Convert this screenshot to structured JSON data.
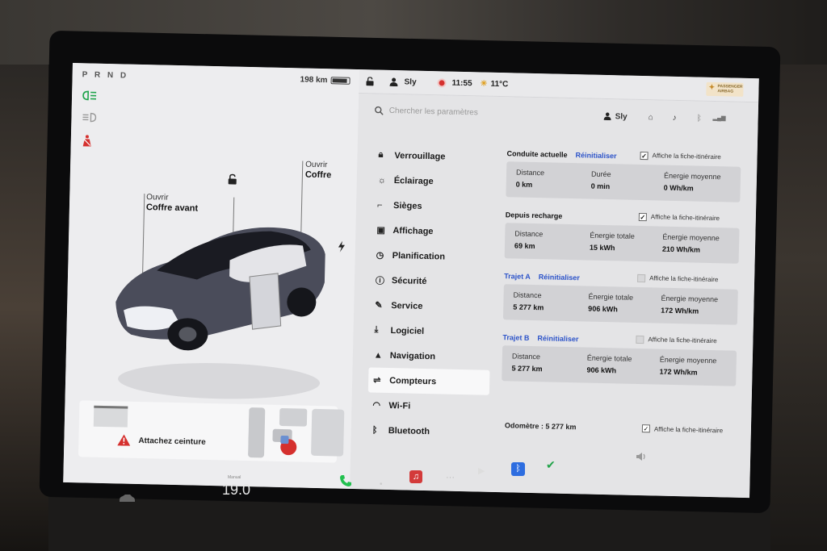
{
  "left_panel": {
    "gear": "P R N D",
    "range": "198 km",
    "battery_level": 0.8,
    "callout_trunk": {
      "line1": "Ouvrir",
      "line2": "Coffre"
    },
    "callout_frunk": {
      "line1": "Ouvrir",
      "line2": "Coffre avant"
    },
    "seatbelt_warning": "Attachez ceinture",
    "icons": [
      "headlights-icon",
      "high-beam-icon",
      "seatbelt-warning-icon",
      "unlock-icon",
      "charge-bolt-icon"
    ]
  },
  "status_bar": {
    "user": "Sly",
    "time": "11:55",
    "temperature": "11°C",
    "airbag_badge": "PASSENGER AIRBAG"
  },
  "settings": {
    "search_placeholder": "Chercher les paramètres",
    "profile": "Sly",
    "menu": [
      {
        "label": "Verrouillage",
        "icon": "lock-icon"
      },
      {
        "label": "Éclairage",
        "icon": "sun-icon"
      },
      {
        "label": "Sièges",
        "icon": "seat-icon"
      },
      {
        "label": "Affichage",
        "icon": "display-icon"
      },
      {
        "label": "Planification",
        "icon": "clock-icon"
      },
      {
        "label": "Sécurité",
        "icon": "info-icon"
      },
      {
        "label": "Service",
        "icon": "wrench-icon"
      },
      {
        "label": "Logiciel",
        "icon": "download-icon"
      },
      {
        "label": "Navigation",
        "icon": "navigation-icon"
      },
      {
        "label": "Compteurs",
        "icon": "trips-icon"
      },
      {
        "label": "Wi-Fi",
        "icon": "wifi-icon"
      },
      {
        "label": "Bluetooth",
        "icon": "bluetooth-icon"
      }
    ],
    "active_menu": "Compteurs",
    "reset_label": "Réinitialiser",
    "show_on_trip_card": "Affiche la fiche-itinéraire",
    "sections": {
      "current": {
        "title": "Conduite actuelle",
        "c1_label": "Distance",
        "c1_value": "0 km",
        "c2_label": "Durée",
        "c2_value": "0 min",
        "c3_label": "Énergie moyenne",
        "c3_value": "0 Wh/km",
        "checked": true
      },
      "since_charge": {
        "title": "Depuis recharge",
        "c1_label": "Distance",
        "c1_value": "69 km",
        "c2_label": "Énergie totale",
        "c2_value": "15 kWh",
        "c3_label": "Énergie moyenne",
        "c3_value": "210 Wh/km",
        "checked": true
      },
      "trip_a": {
        "title": "Trajet A",
        "c1_label": "Distance",
        "c1_value": "5 277 km",
        "c2_label": "Énergie totale",
        "c2_value": "906 kWh",
        "c3_label": "Énergie moyenne",
        "c3_value": "172 Wh/km",
        "checked": false
      },
      "trip_b": {
        "title": "Trajet B",
        "c1_label": "Distance",
        "c1_value": "5 277 km",
        "c2_label": "Énergie totale",
        "c2_value": "906 kWh",
        "c3_label": "Énergie moyenne",
        "c3_value": "172 Wh/km",
        "checked": false
      }
    },
    "odometer": "Odomètre : 5 277 km",
    "odometer_checked": true
  },
  "dock": {
    "temperature": "19.0",
    "temperature_label": "Manual",
    "items": [
      "phone-icon",
      "music-icon",
      "more-icon",
      "media-icon",
      "bluetooth-app-icon",
      "checkmark-app-icon"
    ],
    "colors": {
      "phone": "#22c04f",
      "music": "#d33a3a",
      "bluetooth": "#2d6de0",
      "check": "#22a34a"
    }
  }
}
